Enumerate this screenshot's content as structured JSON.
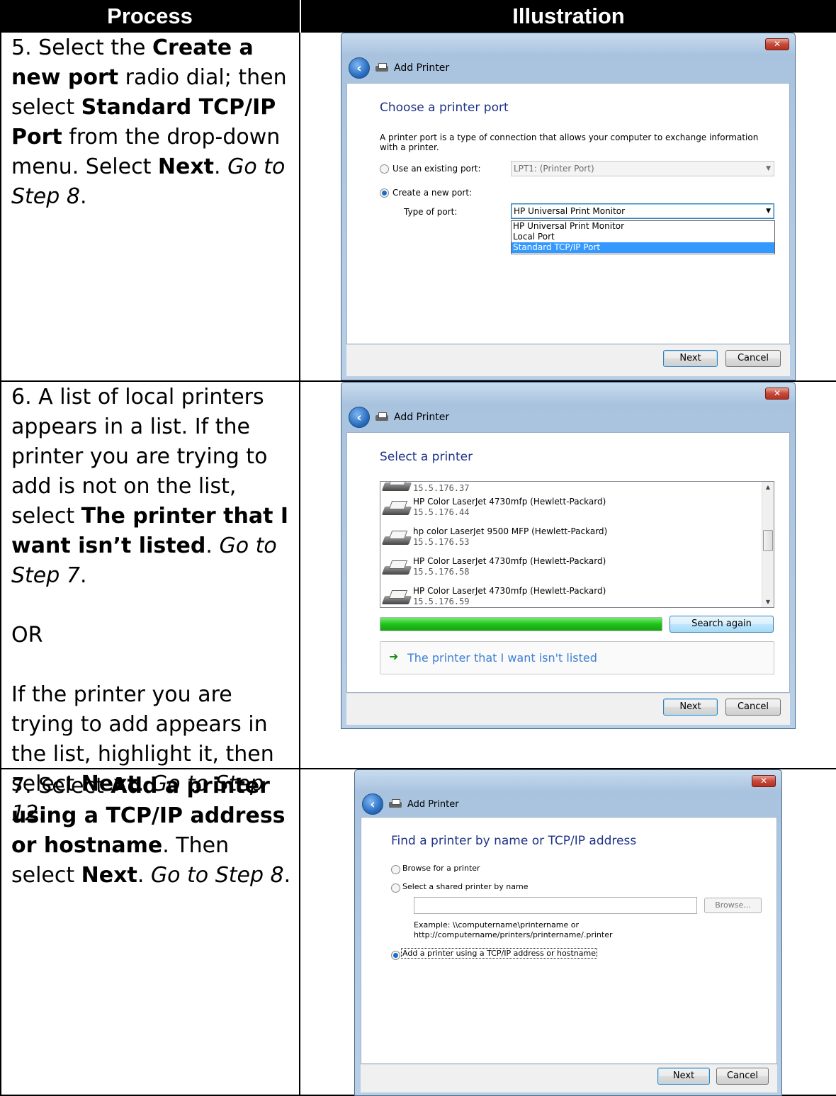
{
  "table": {
    "headers": [
      "Process",
      "Illustration"
    ],
    "rows": [
      {
        "process": [
          [
            "5. Select the ",
            "Create a new port",
            " radio dial; then select ",
            "Standard TCP/IP Port",
            " from the drop-down menu. Select ",
            "Next",
            ". ",
            "Go to Step 8",
            "."
          ]
        ]
      },
      {
        "process": [
          [
            "6. A list of local printers appears in a list. If the printer you are trying to add is not on the list, select ",
            "The printer that I want isn’t listed",
            ". ",
            "Go to Step 7",
            "."
          ],
          [
            "OR"
          ],
          [
            "If the printer you are trying to add appears in the list, highlight it, then select ",
            "Next",
            ". ",
            "Go to Step 12",
            "."
          ]
        ]
      },
      {
        "process": [
          [
            "7. Select ",
            "Add a printer using a TCP/IP address or hostname",
            ". Then select ",
            "Next",
            ". ",
            "Go to Step 8",
            "."
          ]
        ]
      }
    ]
  },
  "window1": {
    "close": "✕",
    "title": "Add Printer",
    "heading": "Choose a printer port",
    "description": "A printer port is a type of connection that allows your computer to exchange information with a printer.",
    "existing_label": "Use an existing port:",
    "existing_value": "LPT1: (Printer Port)",
    "create_label": "Create a new port:",
    "type_label": "Type of port:",
    "type_value": "HP Universal Print Monitor",
    "options": [
      "HP Universal Print Monitor",
      "Local Port",
      "Standard TCP/IP Port"
    ],
    "selected_option": "Standard TCP/IP Port",
    "next": "Next",
    "cancel": "Cancel"
  },
  "window2": {
    "close": "✕",
    "title": "Add Printer",
    "heading": "Select a printer",
    "partial_ip": "15.5.176.37",
    "printers": [
      {
        "name": "HP Color LaserJet 4730mfp (Hewlett-Packard)",
        "ip": "15.5.176.44"
      },
      {
        "name": "hp color LaserJet 9500 MFP (Hewlett-Packard)",
        "ip": "15.5.176.53"
      },
      {
        "name": "HP Color LaserJet 4730mfp (Hewlett-Packard)",
        "ip": "15.5.176.58"
      },
      {
        "name": "HP Color LaserJet 4730mfp (Hewlett-Packard)",
        "ip": "15.5.176.59"
      }
    ],
    "search_progress": 1.0,
    "search_again": "Search again",
    "not_listed": "The printer that I want isn't listed",
    "next": "Next",
    "cancel": "Cancel"
  },
  "window3": {
    "close": "✕",
    "title": "Add Printer",
    "heading": "Find a printer by name or TCP/IP address",
    "browse_label": "Browse for a printer",
    "shared_label": "Select a shared printer by name",
    "browse_btn": "Browse...",
    "example_line1": "Example: \\\\computername\\printername or",
    "example_line2": "http://computername/printers/printername/.printer",
    "tcp_label": "Add a printer using a TCP/IP address or hostname",
    "next": "Next",
    "cancel": "Cancel"
  }
}
